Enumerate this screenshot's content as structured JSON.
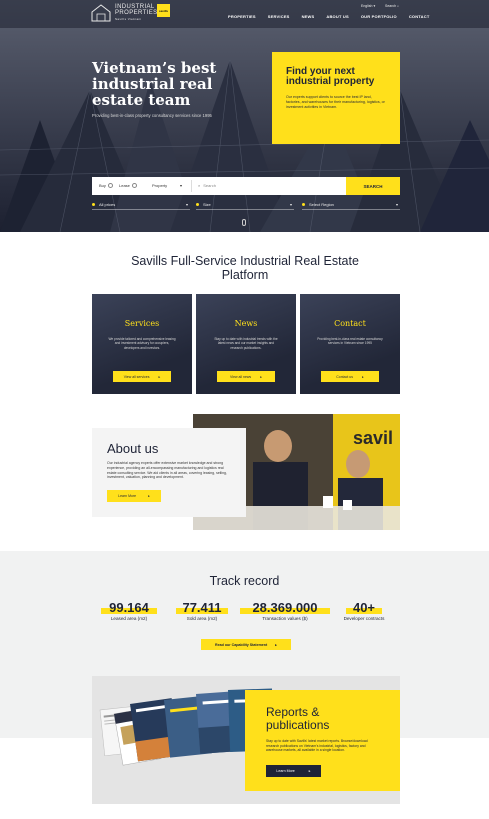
{
  "header": {
    "logo_line1": "INDUSTRIAL",
    "logo_line2": "PROPERTIES",
    "logo_line3": "Savills Vietnam",
    "badge": "savills",
    "language": "English",
    "search_label": "Search",
    "nav": [
      "PROPERTIES",
      "SERVICES",
      "NEWS",
      "ABOUT US",
      "OUR PORTFOLIO",
      "CONTACT"
    ]
  },
  "hero": {
    "title": "Vietnam’s best industrial real estate team",
    "subtitle": "Providing best-in-class property consultancy services since 1995"
  },
  "find_card": {
    "title": "Find your next industrial property",
    "description": "Our experts support clients to source the best IP land, factories, and warehouses for their manufacturing, logistics, or investment activities in Vietnam."
  },
  "search": {
    "buy": "Buy",
    "lease": "Lease",
    "type": "Property",
    "placeholder": "Search",
    "button": "SEARCH"
  },
  "filters": [
    "All prices",
    "Size",
    "Select Region"
  ],
  "platform": {
    "title": "Savills Full-Service Industrial Real Estate Platform",
    "cards": [
      {
        "title": "Services",
        "desc": "We provide tailored and comprehensive leasing and investment advisory for occupiers, developers and investors.",
        "button": "View all services"
      },
      {
        "title": "News",
        "desc": "Stay up to date with industrial trends with the latest news and our market insights and research publications.",
        "button": "View all news"
      },
      {
        "title": "Contact",
        "desc": "Providing best-in-class real estate consultancy services in Vietnam since 1995",
        "button": "Contact us"
      }
    ]
  },
  "about": {
    "title": "About us",
    "desc": "Our industrial agency experts offer extensive market knowledge and strong experience, providing an all-encompassing manufacturing and logistics real estate consulting service. We aid clients in all areas, covering leasing, selling, investment, valuation, planning and development.",
    "button": "Learn More"
  },
  "track": {
    "title": "Track record",
    "stats": [
      {
        "value": "99.164",
        "label": "Leased area (m2)"
      },
      {
        "value": "77.411",
        "label": "Sold area (m2)"
      },
      {
        "value": "28.369.000",
        "label": "Transaction values ($)"
      },
      {
        "value": "40+",
        "label": "Developer contracts"
      }
    ],
    "button": "Read our Capability Statement"
  },
  "reports": {
    "title": "Reports & publications",
    "desc": "Stay up to date with Savills' latest market reports. Browse/download research publications on Vietnam's industrial, logistics, factory and warehouse markets, all available in a single location.",
    "button": "Learn More"
  },
  "icons": {
    "arrow": "arrow-right-icon",
    "search": "search-icon",
    "chevron": "chevron-down-icon"
  },
  "colors": {
    "accent": "#ffe01b",
    "navy": "#1f2437",
    "card_bg": "#2b3145"
  }
}
